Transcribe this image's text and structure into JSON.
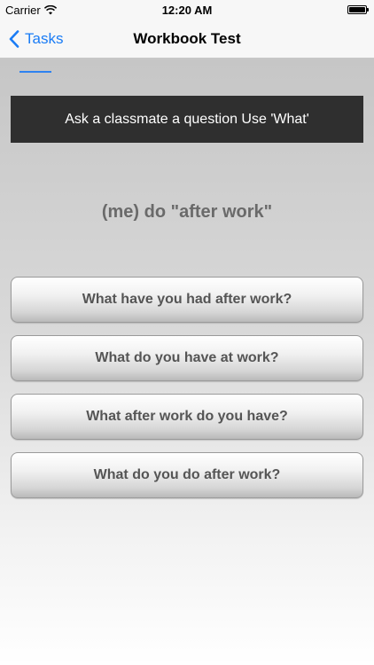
{
  "status_bar": {
    "carrier": "Carrier",
    "time": "12:20 AM"
  },
  "nav": {
    "back_label": "Tasks",
    "title": "Workbook Test"
  },
  "prompt": {
    "instruction": "Ask a classmate a question Use 'What'",
    "question": "(me) do \"after work\""
  },
  "answers": [
    {
      "label": "What have you had after work?"
    },
    {
      "label": "What do you have at work?"
    },
    {
      "label": "What after work do you have?"
    },
    {
      "label": "What do you do after work?"
    }
  ],
  "colors": {
    "accent": "#1a7cf5",
    "banner_bg": "#2f2f2f",
    "button_text": "#555555",
    "question_text": "#6a6a6a"
  },
  "icons": {
    "wifi": "wifi-icon",
    "battery": "battery-icon",
    "back": "chevron-left-icon"
  }
}
